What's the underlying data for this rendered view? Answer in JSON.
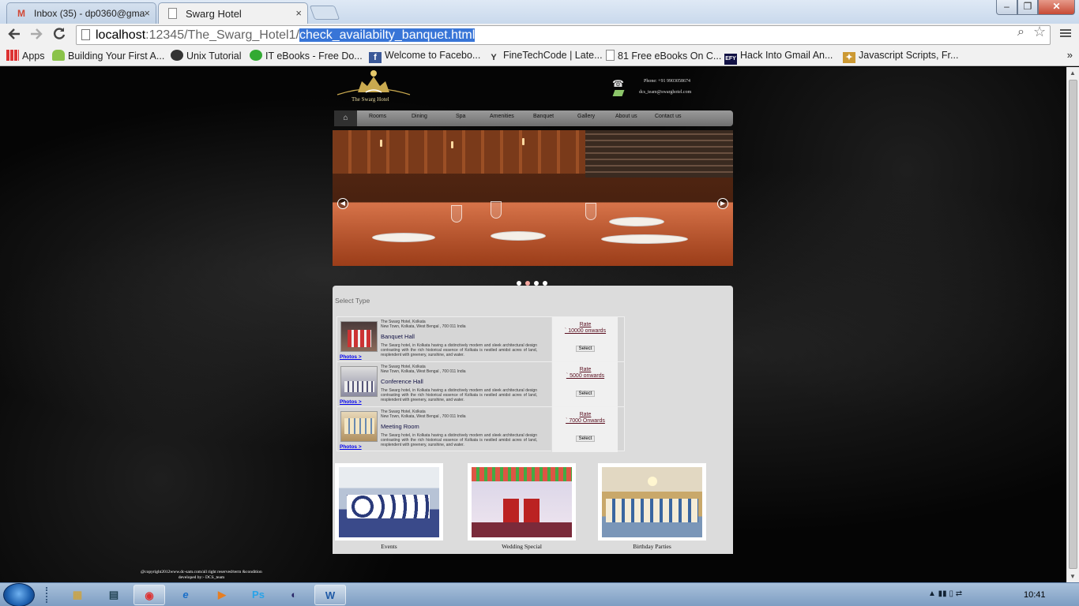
{
  "browser": {
    "tabs": [
      {
        "title": "Inbox (35) - dp0360@gma",
        "close": "×",
        "icon": "gmail-icon"
      },
      {
        "title": "Swarg Hotel",
        "close": "×",
        "icon": "page-icon"
      }
    ],
    "window_controls": {
      "minimize": "–",
      "maximize": "❐",
      "close": "✕"
    },
    "url": {
      "host": "localhost",
      "path": ":12345/The_Swarg_Hotel1/",
      "selected": "check_availabilty_banquet.html"
    },
    "bookmarks": [
      {
        "label": "Apps",
        "icon": "apps-icon"
      },
      {
        "label": "Building Your First A...",
        "icon": "android-icon"
      },
      {
        "label": "Unix Tutorial",
        "icon": "unix-icon"
      },
      {
        "label": "IT eBooks - Free Do...",
        "icon": "itebooks-icon"
      },
      {
        "label": "Welcome to Facebo...",
        "icon": "facebook-icon"
      },
      {
        "label": "FineTechCode | Late...",
        "icon": "finetech-icon"
      },
      {
        "label": "81 Free eBooks On C...",
        "icon": "page-icon"
      },
      {
        "label": "Hack Into Gmail An...",
        "icon": "efy-icon"
      },
      {
        "label": "Javascript Scripts, Fr...",
        "icon": "js-icon"
      }
    ],
    "bookmarks_more": "»"
  },
  "site": {
    "logo_text": "The Swarg Hotel",
    "contact_phone": "Phone: +91 9903058674",
    "contact_email": "dcs_team@swarghotel.com",
    "nav": [
      "Rooms",
      "Dining",
      "Spa",
      "Amenities",
      "Banquet",
      "Gallery",
      "About us",
      "Contact us"
    ],
    "slider": {
      "prev": "◀",
      "next": "▶",
      "dots": 4,
      "active_dot": 2
    },
    "select_type": "Select Type",
    "rooms": [
      {
        "address1": "The Swarg Hotel, Kolkata",
        "address2": "New Town, Kolkata, West Bengal , 700 011 India",
        "name": "Banquet Hall",
        "desc": "The Swarg hotel, in Kolkata having a distinctively modern and sleek architectural design contrasting with the rich historical essence of Kolkata is nestled amidst acres of land, resplendent with greenery, sunshine, and water.",
        "photos": "Photos >",
        "rate_label": "Rate",
        "rate": "` 10000 onwards",
        "select": "Select"
      },
      {
        "address1": "The Swarg Hotel, Kolkata",
        "address2": "New Town, Kolkata, West Bengal , 700 011 India",
        "name": "Conference Hall",
        "desc": "The Swarg hotel, in Kolkata having a distinctively modern and sleek architectural design contrasting with the rich historical essence of Kolkata is nestled amidst acres of land, resplendent with greenery, sunshine, and water.",
        "photos": "Photos >",
        "rate_label": "Rate",
        "rate": "` 5000 onwards",
        "select": "Select"
      },
      {
        "address1": "The Swarg Hotel, Kolkata",
        "address2": "New Town, Kolkata, West Bengal , 700 011 India",
        "name": "Meeting Room",
        "desc": "The Swarg hotel, in Kolkata having a distinctively modern and sleek architectural design contrasting with the rich historical essence of Kolkata is nestled amidst acres of land, resplendent with greenery, sunshine, and water.",
        "photos": "Photos >",
        "rate_label": "Rate",
        "rate": "` 7000 Onwards",
        "select": "Select"
      }
    ],
    "gallery": [
      {
        "caption": "Events"
      },
      {
        "caption": "Wedding Special"
      },
      {
        "caption": "Birthday Parties"
      }
    ],
    "footer1": "@copyright2012www.dc-sam.com/all right reserved/term &condition",
    "footer2": "developed by:- DCS_team"
  },
  "taskbar": {
    "apps": [
      {
        "name": "explorer",
        "glyph": "▦"
      },
      {
        "name": "windows-explorer",
        "glyph": "▤"
      },
      {
        "name": "chrome",
        "glyph": "◉"
      },
      {
        "name": "internet-explorer",
        "glyph": "e"
      },
      {
        "name": "media-player",
        "glyph": "▶"
      },
      {
        "name": "photoshop",
        "glyph": "Ps"
      },
      {
        "name": "eclipse",
        "glyph": "◐"
      },
      {
        "name": "word",
        "glyph": "W"
      }
    ],
    "tray_icons": "▲ ▮▮ ▯ ⇄",
    "clock": "10:41"
  }
}
